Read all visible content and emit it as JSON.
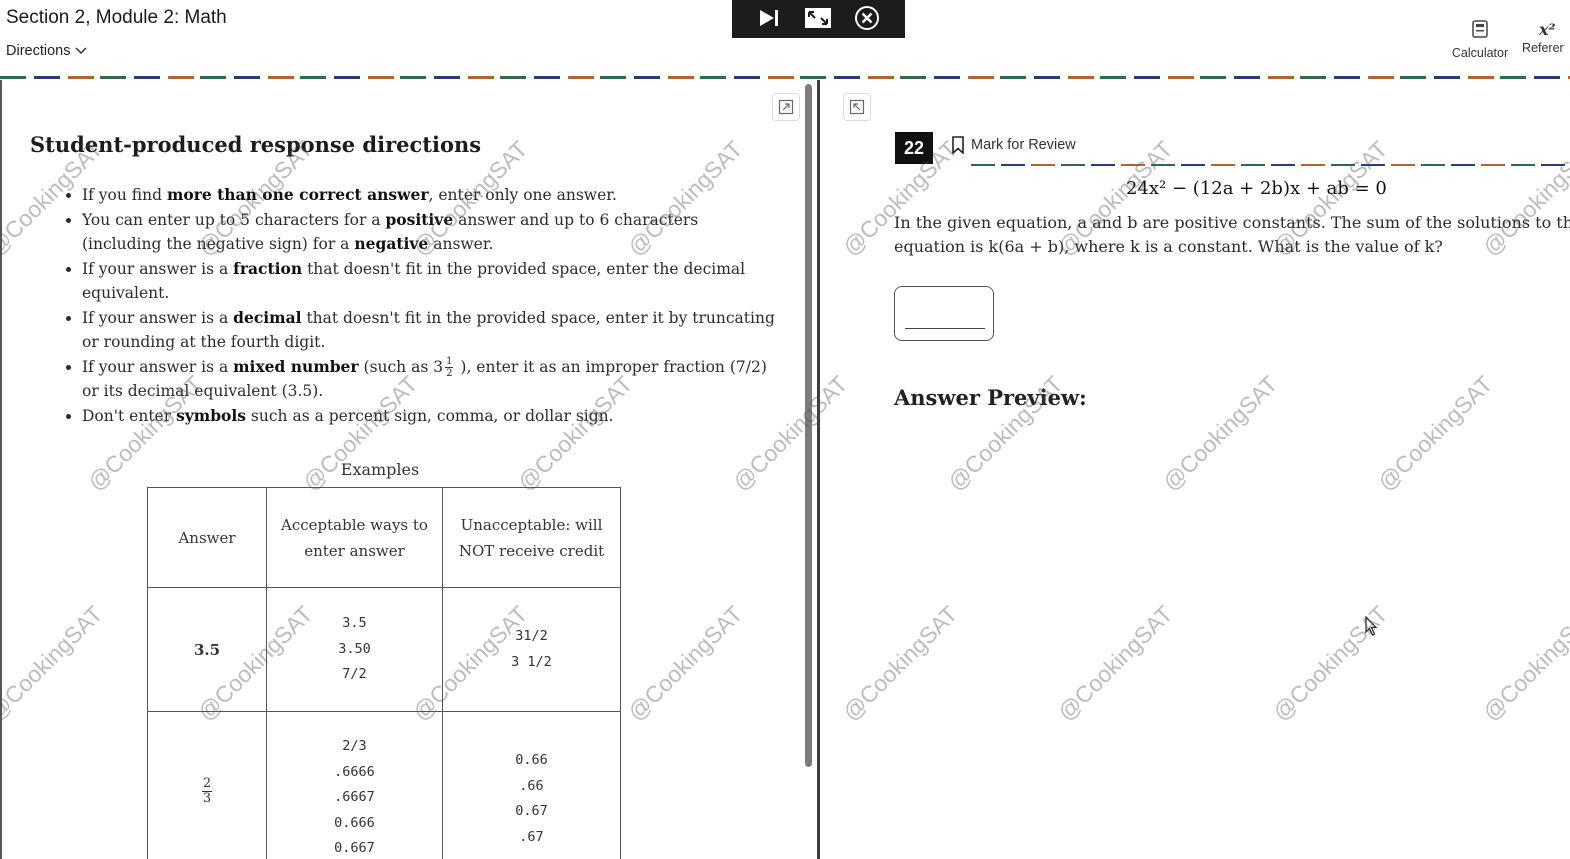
{
  "header": {
    "section_title": "Section 2, Module 2: Math",
    "directions_label": "Directions",
    "tools": {
      "calculator_label": "Calculator",
      "reference_label": "Referer",
      "reference_glyph": "x²"
    },
    "player_icons": [
      "skip-icon",
      "exit-fullscreen-icon",
      "close-icon"
    ]
  },
  "directions": {
    "heading": "Student-produced response directions",
    "rules": {
      "r1": {
        "a": "If you find ",
        "b": "more than one correct answer",
        "c": ", enter only one answer."
      },
      "r2": {
        "a": "You can enter up to 5 characters for a ",
        "b": "positive",
        "c": " answer and up to 6 characters (including the negative sign) for a ",
        "d": "negative",
        "e": " answer."
      },
      "r3": {
        "a": "If your answer is a ",
        "b": "fraction",
        "c": " that doesn't fit in the provided space, enter the decimal equivalent."
      },
      "r4": {
        "a": "If your answer is a ",
        "b": "decimal",
        "c": " that doesn't fit in the provided space, enter it by truncating or rounding at the fourth digit."
      },
      "r5": {
        "a": "If your answer is a ",
        "b": "mixed number",
        "c": " (such as ",
        "whole": "3",
        "num": "1",
        "den": "2",
        "d": " ), enter it as an improper fraction (7/2) or its decimal equivalent (3.5)."
      },
      "r6": {
        "a": "Don't enter ",
        "b": "symbols",
        "c": " such as a percent sign, comma, or dollar sign."
      }
    },
    "examples": {
      "caption": "Examples",
      "headers": {
        "answer": "Answer",
        "acceptable": "Acceptable ways to enter answer",
        "unacceptable": "Unacceptable: will NOT receive credit"
      },
      "row1": {
        "answer": "3.5",
        "acceptable": [
          "3.5",
          "3.50",
          "7/2"
        ],
        "unacceptable": [
          "31/2",
          "3 1/2"
        ]
      },
      "row2": {
        "answer_num": "2",
        "answer_den": "3",
        "acceptable": [
          "2/3",
          ".6666",
          ".6667",
          "0.666",
          "0.667"
        ],
        "unacceptable": [
          "0.66",
          ".66",
          "0.67",
          ".67"
        ]
      }
    }
  },
  "question": {
    "number": "22",
    "mark_label": "Mark for Review",
    "equation": "24x² − (12a + 2b)x + ab = 0",
    "text_line1": "In the given equation, a and b are positive constants. The sum of the solutions to the give",
    "text_line2": "equation is  k(6a + b), where k is a constant. What is the value of k?",
    "answer_value": "",
    "preview_label": "Answer Preview:"
  },
  "watermark_text": "@CookingSAT"
}
